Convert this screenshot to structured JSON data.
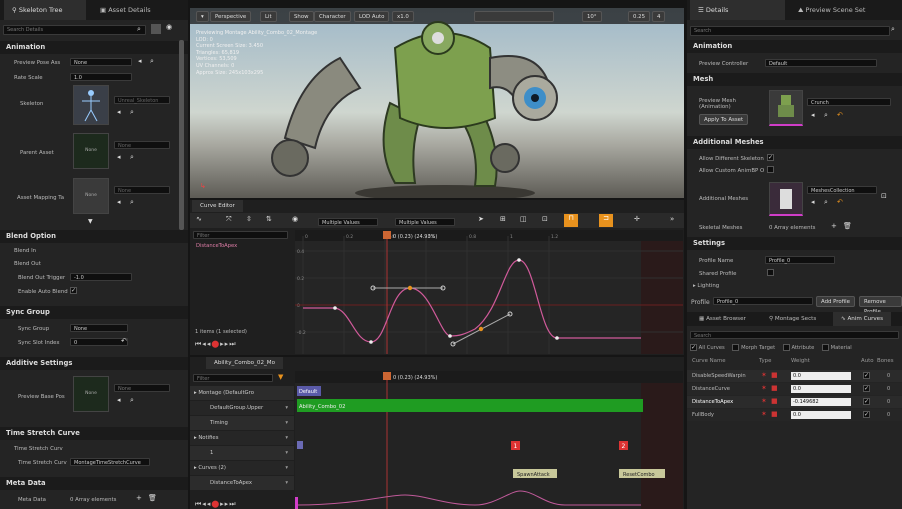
{
  "left": {
    "tabs": [
      "Skeleton Tree",
      "Asset Details"
    ],
    "search": "Search Details",
    "animation": {
      "title": "Animation",
      "preview_pose_asset": "Preview Pose Ass",
      "preview_pose_value": "None",
      "rate_scale": "Rate Scale",
      "rate_value": "1.0",
      "skeleton": "Skeleton",
      "skeleton_asset": "Unreal_Skeleton",
      "parent_asset": "Parent Asset",
      "parent_value": "None",
      "asset_mapping": "Asset Mapping Ta",
      "mapping_value": "None",
      "thumb_none": "None"
    },
    "blend": {
      "title": "Blend Option",
      "blend_in": "Blend In",
      "blend_out": "Blend Out",
      "blend_out_trigger": "Blend Out Trigger",
      "trigger_value": "-1.0",
      "enable_auto_blend": "Enable Auto Blend"
    },
    "sync": {
      "title": "Sync Group",
      "sync_group": "Sync Group",
      "group_value": "None",
      "slot_index": "Sync Slot Index",
      "slot_value": "0"
    },
    "additive": {
      "title": "Additive Settings",
      "base_pose": "Preview Base Pos",
      "value": "None"
    },
    "stretch": {
      "title": "Time Stretch Curve",
      "curve": "Time Stretch Curv",
      "curve_name": "Time Stretch Curv",
      "curve_value": "MontageTimeStretchCurve"
    },
    "meta": {
      "title": "Meta Data",
      "label": "Meta Data",
      "value": "0 Array elements"
    }
  },
  "viewport": {
    "buttons": [
      "Perspective",
      "Lit",
      "Show",
      "Character",
      "LOD Auto",
      "x1.0"
    ],
    "overlay": [
      "Previewing Montage Ability_Combo_02_Montage",
      "LOD: 0",
      "Current Screen Size: 3.450",
      "Triangles: 65,819",
      "Vertices: 53,509",
      "UV Channels: 0",
      "Approx Size: 245x103x295"
    ],
    "right_nums": [
      "10°",
      "0.25",
      "4"
    ]
  },
  "curve_editor": {
    "tab": "Curve Editor",
    "dropdowns": [
      "Multiple Values",
      "Multiple Values"
    ],
    "filter": "Filter",
    "curve_list": [
      "DistanceToApex"
    ],
    "items_selected": "1 items (1 selected)",
    "time": "0 (0.23) (24.93%)",
    "ticks": [
      "0",
      "0.2",
      "0.4",
      "0.6",
      "0.8",
      "1",
      "1.2"
    ],
    "yticks": [
      "0.4",
      "0.2",
      "0",
      "-0.2"
    ]
  },
  "montage": {
    "tab": "Ability_Combo_02_Mo",
    "filter": "Filter",
    "time": "0 (0.23) (24.93%)",
    "tracks": [
      "Montage (DefaultGro",
      "DefaultGroup.Upper",
      "Timing",
      "Notifies",
      "1",
      "Curves (2)",
      "DistanceToApex"
    ],
    "default": "Default",
    "section": "Ability_Combo_02",
    "markers": [
      "1",
      "2"
    ],
    "notifies": [
      "SpawnAttack",
      "ResetCombo"
    ]
  },
  "right": {
    "tabs": [
      "Details",
      "Preview Scene Set"
    ],
    "search": "Search",
    "animation": {
      "title": "Animation",
      "preview_controller": "Preview Controller",
      "value": "Default"
    },
    "mesh": {
      "title": "Mesh",
      "preview_mesh": "Preview Mesh (Animation)",
      "value": "Crunch",
      "apply": "Apply To Asset"
    },
    "additional": {
      "title": "Additional Meshes",
      "allow_diff": "Allow Different Skeleton",
      "allow_custom": "Allow Custom AnimBP O",
      "meshes": "Additional Meshes",
      "mesh_value": "MeshesCollection",
      "skeletal": "Skeletal Meshes",
      "skeletal_value": "0 Array elements"
    },
    "settings": {
      "title": "Settings",
      "profile_name": "Profile Name",
      "profile_value": "Profile_0",
      "shared": "Shared Profile",
      "lighting": "Lighting"
    },
    "profile": {
      "label": "Profile",
      "value": "Profile_0",
      "add": "Add Profile",
      "remove": "Remove Profile"
    },
    "bottom_tabs": [
      "Asset Browser",
      "Montage Sects",
      "Anim Curves"
    ],
    "filters": [
      "All Curves",
      "Morph Target",
      "Attribute",
      "Material"
    ],
    "table_headers": [
      "Curve Name",
      "Type",
      "Weight",
      "Auto",
      "Bones"
    ],
    "curves": [
      {
        "name": "DisableSpeedWarpin",
        "weight": "0.0"
      },
      {
        "name": "DistanceCurve",
        "weight": "0.0"
      },
      {
        "name": "DistanceToApex",
        "weight": "-0.149682"
      },
      {
        "name": "FullBody",
        "weight": "0.0"
      }
    ]
  }
}
